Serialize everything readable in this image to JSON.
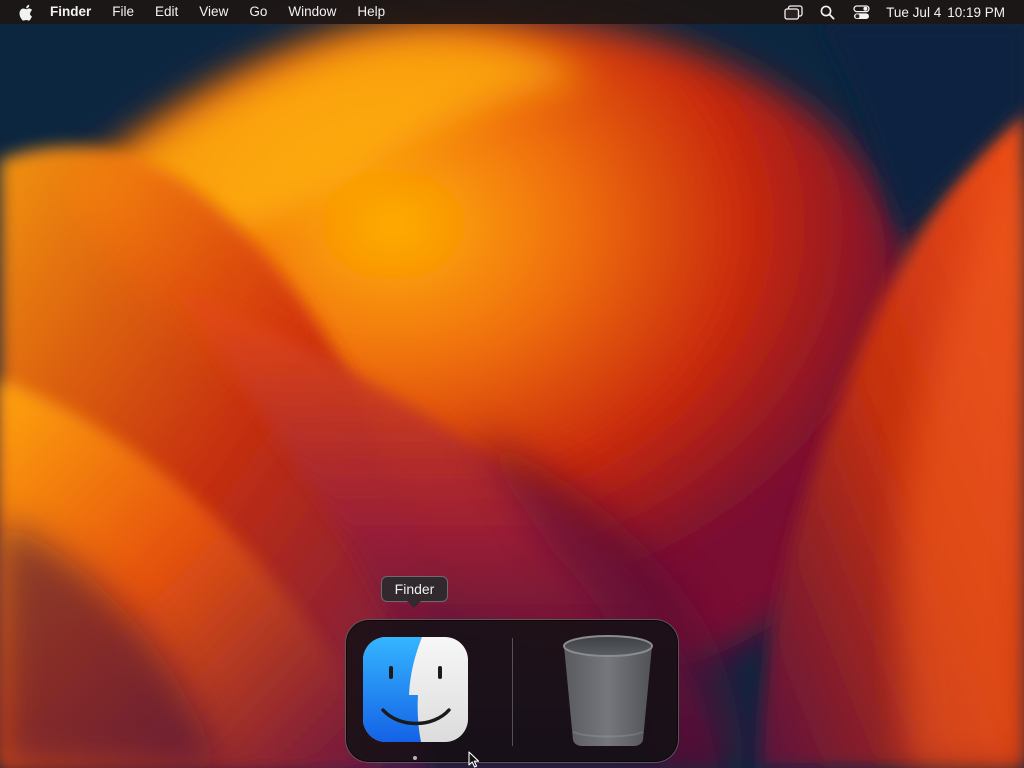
{
  "menubar": {
    "app_name": "Finder",
    "menus": [
      "File",
      "Edit",
      "View",
      "Go",
      "Window",
      "Help"
    ],
    "status_icons": [
      "screen-mirroring-icon",
      "spotlight-search-icon",
      "control-center-icon"
    ],
    "clock": {
      "date": "Tue Jul 4",
      "time": "10:19 PM"
    }
  },
  "dock": {
    "tooltip": "Finder",
    "items": [
      {
        "name": "Finder",
        "icon": "finder-icon",
        "running": true
      },
      {
        "name": "Trash",
        "icon": "trash-icon",
        "running": false
      }
    ]
  },
  "colors": {
    "menubar_bg": "#1e1614",
    "wallpaper_dark": "#0d2a44",
    "wallpaper_orange": "#f08a12",
    "wallpaper_red": "#d23a10",
    "wallpaper_magenta": "#7a1b4a",
    "finder_blue": "#1e7af0",
    "finder_light": "#eeeeee"
  }
}
